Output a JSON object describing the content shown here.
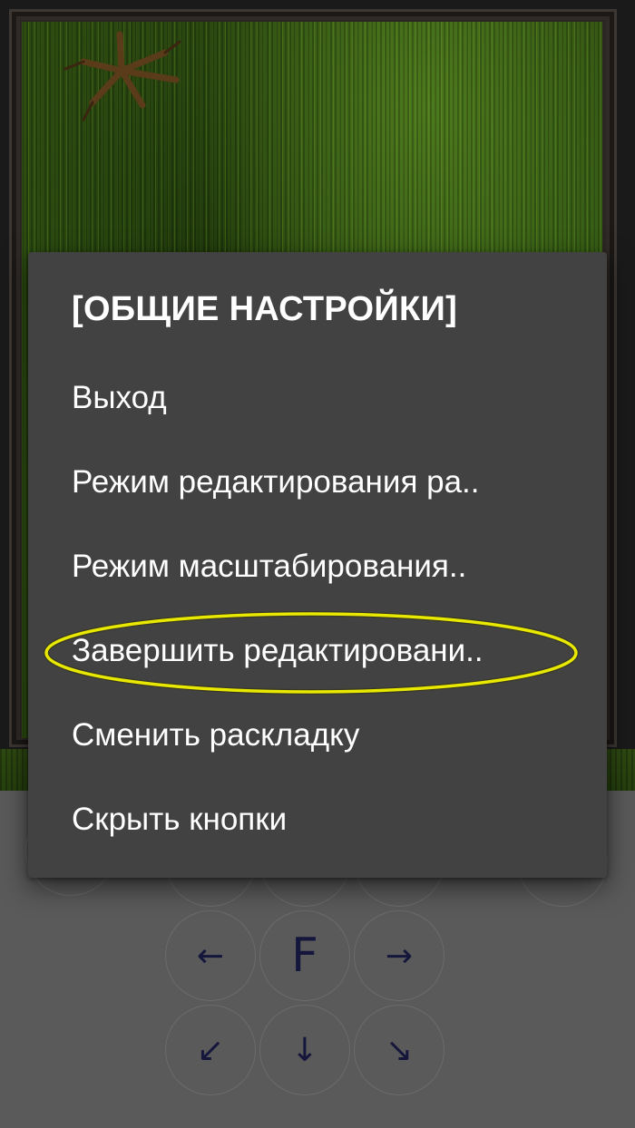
{
  "dialog": {
    "title": "[ОБЩИЕ НАСТРОЙКИ]",
    "items": [
      {
        "label": "Выход"
      },
      {
        "label": "Режим редактирования ра.."
      },
      {
        "label": "Режим масштабирования.."
      },
      {
        "label": "Завершить редактировани..",
        "highlighted": true
      },
      {
        "label": "Сменить раскладку"
      },
      {
        "label": "Скрыть кнопки"
      }
    ],
    "highlight_color": "#e8e800"
  },
  "controls": {
    "buttons": [
      {
        "name": "dpad-up-left",
        "label": "↖"
      },
      {
        "name": "dpad-up",
        "label": "↑"
      },
      {
        "name": "dpad-up-right",
        "label": "↗"
      },
      {
        "name": "dpad-left",
        "label": "←"
      },
      {
        "name": "dpad-center",
        "label": "F"
      },
      {
        "name": "dpad-right",
        "label": "→"
      },
      {
        "name": "dpad-down-left",
        "label": "↙"
      },
      {
        "name": "dpad-down",
        "label": "↓"
      },
      {
        "name": "dpad-down-right",
        "label": "↘"
      }
    ],
    "text_color": "#14163c"
  },
  "colors": {
    "dialog_bg": "#424242",
    "controls_bg": "#5a5a5a",
    "grass": "#325a14"
  }
}
